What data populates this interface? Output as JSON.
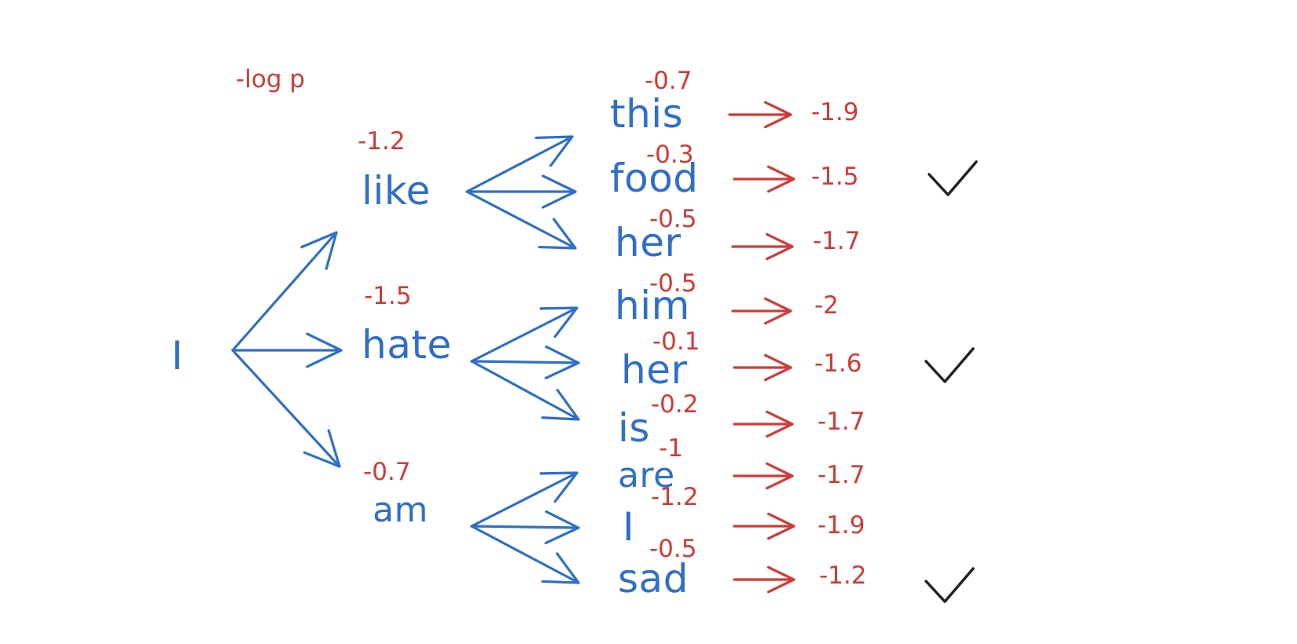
{
  "header": {
    "label": "-log p"
  },
  "root": {
    "word": "I"
  },
  "level1": [
    {
      "word": "like",
      "score": "-1.2"
    },
    {
      "word": "hate",
      "score": "-1.5"
    },
    {
      "word": "am",
      "score": "-0.7"
    }
  ],
  "level2": [
    {
      "word": "this",
      "score": "-0.7",
      "total": "-1.9",
      "selected": false
    },
    {
      "word": "food",
      "score": "-0.3",
      "total": "-1.5",
      "selected": true
    },
    {
      "word": "her",
      "score": "-0.5",
      "total": "-1.7",
      "selected": false
    },
    {
      "word": "him",
      "score": "-0.5",
      "total": "-2",
      "selected": false
    },
    {
      "word": "her",
      "score": "-0.1",
      "total": "-1.6",
      "selected": true
    },
    {
      "word": "is",
      "score": "-0.2",
      "total": "-1.7",
      "selected": false
    },
    {
      "word": "are",
      "score": "-1",
      "total": "-1.7",
      "selected": false
    },
    {
      "word": "I",
      "score": "-1.2",
      "total": "-1.9",
      "selected": false
    },
    {
      "word": "sad",
      "score": "-0.5",
      "total": "-1.2",
      "selected": true
    }
  ],
  "colors": {
    "word": "#2f6fc7",
    "score": "#d23a36",
    "check": "#222222"
  }
}
